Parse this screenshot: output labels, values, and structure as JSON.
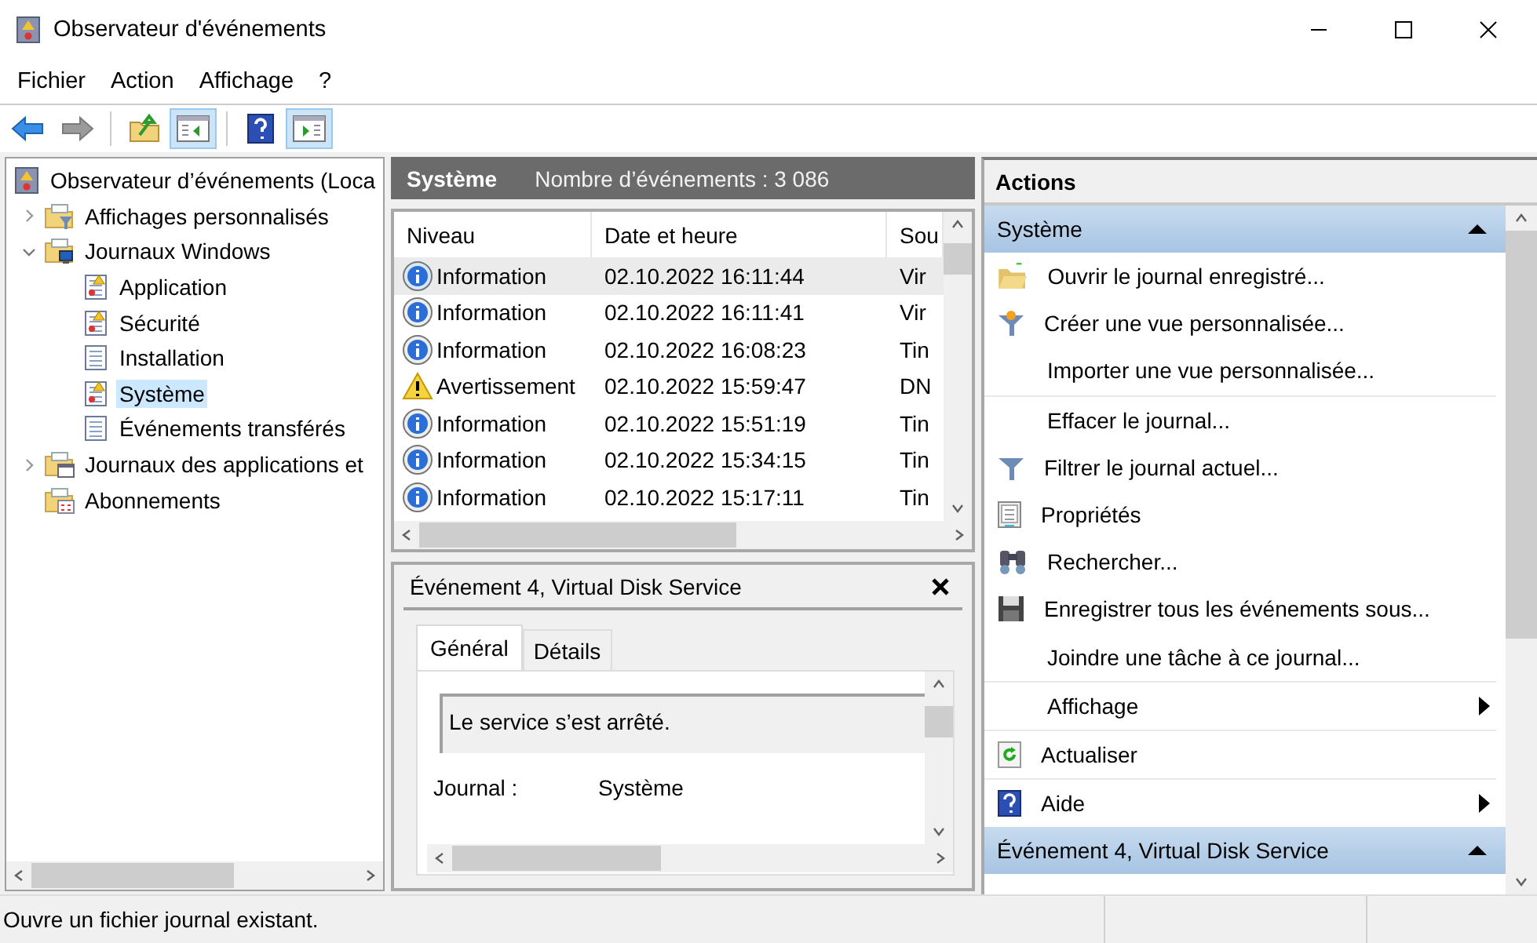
{
  "window": {
    "title": "Observateur d'événements"
  },
  "menu": [
    "Fichier",
    "Action",
    "Affichage",
    "?"
  ],
  "toolbar": [
    {
      "kind": "back",
      "disabled": false,
      "on": false
    },
    {
      "kind": "forward",
      "disabled": true,
      "on": false
    },
    {
      "kind": "open",
      "disabled": false,
      "on": false
    },
    {
      "kind": "tree-pane",
      "disabled": false,
      "on": true
    },
    {
      "kind": "help",
      "disabled": false,
      "on": false
    },
    {
      "kind": "action-pane",
      "disabled": false,
      "on": true
    }
  ],
  "tree": [
    {
      "label": "Observateur d’événements (Loca",
      "kind": "log-root",
      "selected": false,
      "children": [
        {
          "label": "Affichages personnalisés",
          "kind": "folder-filter",
          "expanded": false,
          "selected": false
        },
        {
          "label": "Journaux Windows",
          "kind": "folder-computer",
          "expanded": true,
          "selected": false,
          "children": [
            {
              "label": "Application",
              "kind": "log-warning",
              "selected": false
            },
            {
              "label": "Sécurité",
              "kind": "log-warning",
              "selected": false
            },
            {
              "label": "Installation",
              "kind": "log",
              "selected": false
            },
            {
              "label": "Système",
              "kind": "log-warning",
              "selected": true
            },
            {
              "label": "Événements transférés",
              "kind": "log",
              "selected": false
            }
          ]
        },
        {
          "label": "Journaux des applications et",
          "kind": "folder",
          "expanded": false,
          "selected": false
        },
        {
          "label": "Abonnements",
          "kind": "folder-subscription",
          "selected": false
        }
      ]
    }
  ],
  "events": {
    "title": "Système",
    "count": "Nombre d’événements : 3 086",
    "columns": [
      "Niveau",
      "Date et heure",
      "Sou"
    ],
    "rows": [
      {
        "kind": "information",
        "level": "Information",
        "date": "02.10.2022 16:11:44",
        "column_3": "Vir",
        "selected": true
      },
      {
        "kind": "information",
        "level": "Information",
        "date": "02.10.2022 16:11:41",
        "column_3": "Vir",
        "selected": false
      },
      {
        "kind": "information",
        "level": "Information",
        "date": "02.10.2022 16:08:23",
        "column_3": "Tin",
        "selected": false
      },
      {
        "kind": "warning",
        "level": "Avertissement",
        "date": "02.10.2022 15:59:47",
        "column_3": "DN",
        "selected": false
      },
      {
        "kind": "information",
        "level": "Information",
        "date": "02.10.2022 15:51:19",
        "column_3": "Tin",
        "selected": false
      },
      {
        "kind": "information",
        "level": "Information",
        "date": "02.10.2022 15:34:15",
        "column_3": "Tin",
        "selected": false
      },
      {
        "kind": "information",
        "level": "Information",
        "date": "02.10.2022 15:17:11",
        "column_3": "Tin",
        "selected": false
      }
    ]
  },
  "detail": {
    "title": "Événement 4, Virtual Disk Service",
    "tabs": [
      {
        "label": "Général",
        "selected": true
      },
      {
        "label": "Détails",
        "selected": false
      }
    ],
    "description": "Le service s’est arrêté.",
    "fields": [
      {
        "label": "Journal :",
        "value": "Système"
      }
    ]
  },
  "actions": {
    "title": "Actions",
    "sections": [
      {
        "title": "Système",
        "expanded": true,
        "groups": [
          [
            {
              "kind": "open",
              "label": "Ouvrir le journal enregistré...",
              "submenu": false
            },
            {
              "kind": "new-filter",
              "label": "Créer une vue personnalisée...",
              "submenu": false
            },
            {
              "kind": "plain",
              "label": "Importer une vue personnalisée...",
              "submenu": false
            }
          ],
          [
            {
              "kind": "plain",
              "label": "Effacer le journal...",
              "submenu": false
            },
            {
              "kind": "filter",
              "label": "Filtrer le journal actuel...",
              "submenu": false
            },
            {
              "kind": "properties",
              "label": "Propriétés",
              "submenu": false
            },
            {
              "kind": "find",
              "label": "Rechercher...",
              "submenu": false
            },
            {
              "kind": "save",
              "label": "Enregistrer tous les événements sous...",
              "submenu": false
            },
            {
              "kind": "plain",
              "label": "Joindre une tâche à ce journal...",
              "submenu": false
            }
          ],
          [
            {
              "kind": "plain",
              "label": "Affichage",
              "submenu": true
            }
          ],
          [
            {
              "kind": "refresh",
              "label": "Actualiser",
              "submenu": false
            }
          ],
          [
            {
              "kind": "help",
              "label": "Aide",
              "submenu": true
            }
          ]
        ]
      },
      {
        "title": "Événement 4, Virtual Disk Service",
        "expanded": true
      }
    ]
  },
  "status_bar": "Ouvre un fichier journal existant."
}
